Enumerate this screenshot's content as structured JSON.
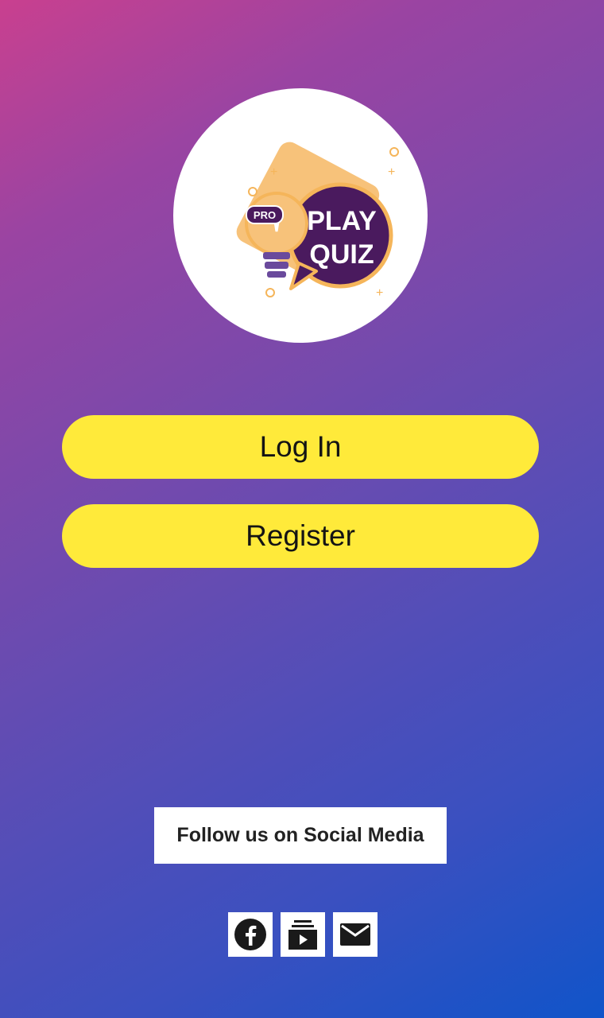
{
  "logo": {
    "badge": "PRO",
    "line1": "PLAY",
    "line2": "QUIZ"
  },
  "actions": {
    "login_label": "Log In",
    "register_label": "Register"
  },
  "social": {
    "heading": "Follow us on Social Media",
    "icons": [
      "facebook-icon",
      "youtube-subscriptions-icon",
      "email-icon"
    ]
  },
  "colors": {
    "button_bg": "#ffea3a",
    "gradient_start": "#c9408f",
    "gradient_end": "#1054c9",
    "logo_purple": "#4a1a5e",
    "logo_orange": "#f5b55a"
  }
}
